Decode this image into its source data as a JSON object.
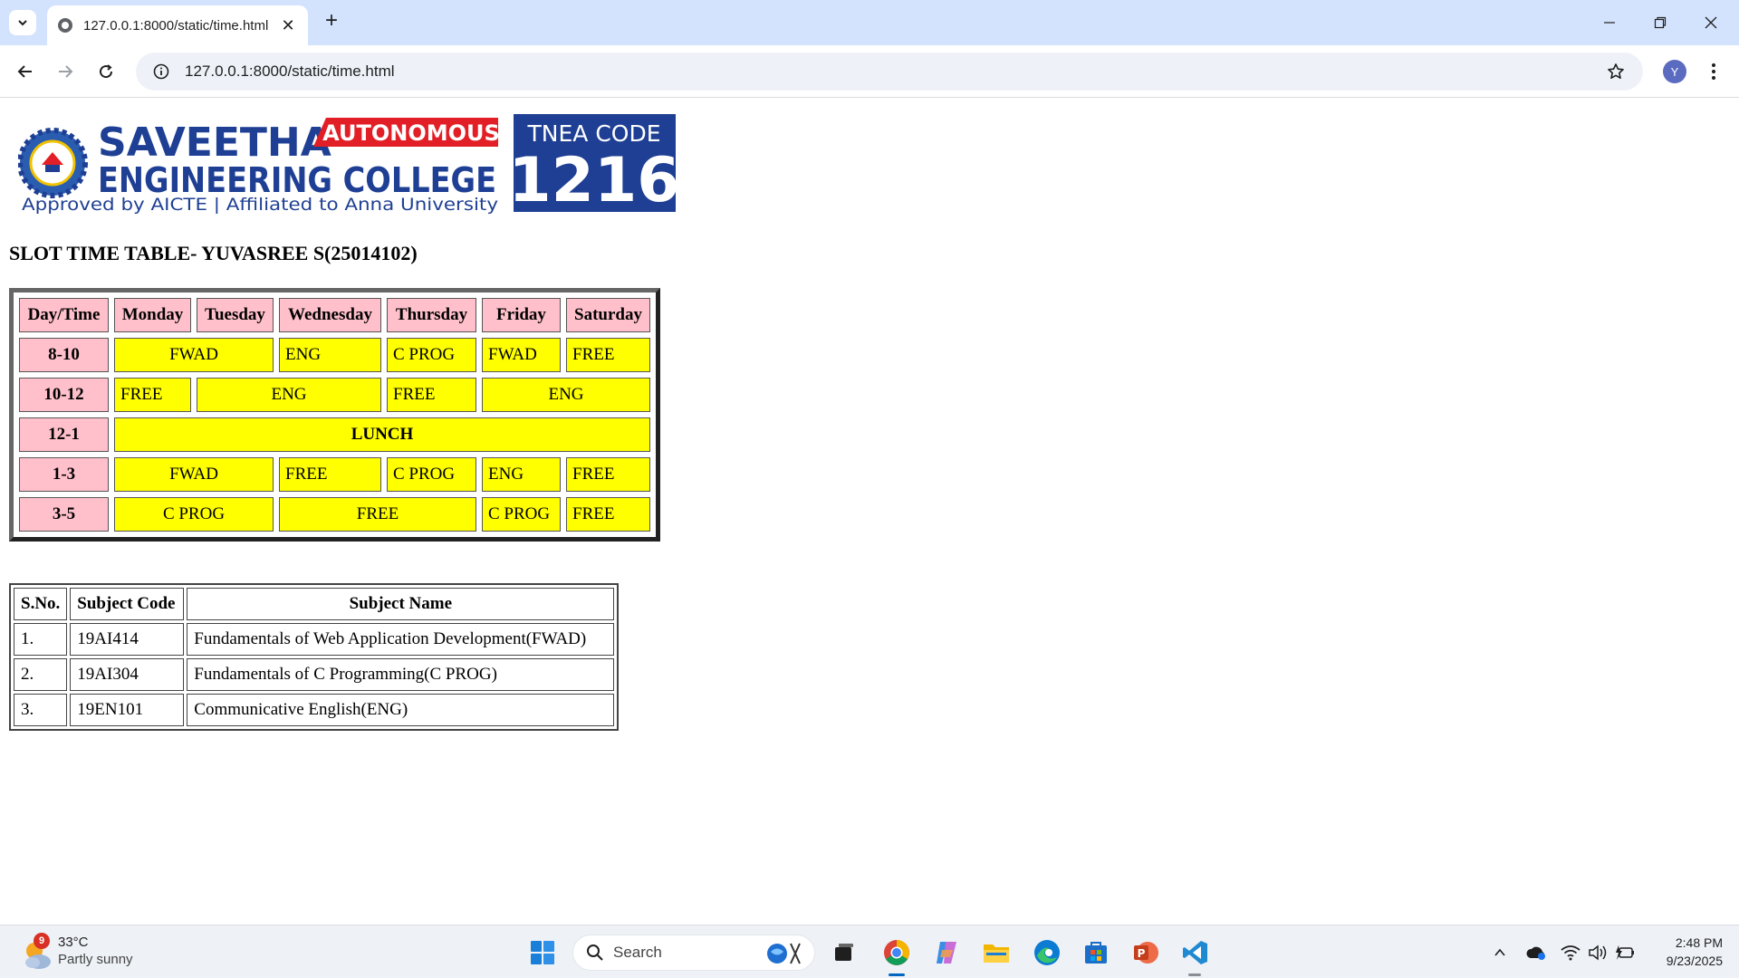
{
  "browser": {
    "tab_title": "127.0.0.1:8000/static/time.html",
    "url": "127.0.0.1:8000/static/time.html",
    "profile_initial": "Y"
  },
  "page": {
    "logo": {
      "name_line1": "SAVEETHA",
      "badge": "AUTONOMOUS",
      "name_line2": "ENGINEERING COLLEGE",
      "tagline": "Approved by AICTE  |  Affiliated to Anna University",
      "code_label": "TNEA CODE",
      "code_number": "1216"
    },
    "heading": "SLOT TIME TABLE- YUVASREE S(25014102)",
    "timetable": {
      "headers": [
        "Day/Time",
        "Monday",
        "Tuesday",
        "Wednesday",
        "Thursday",
        "Friday",
        "Saturday"
      ],
      "rows": [
        {
          "time": "8-10",
          "cells": [
            "FWAD",
            "ENG",
            "C PROG",
            "FWAD",
            "FREE"
          ]
        },
        {
          "time": "10-12",
          "cells": [
            "FREE",
            "ENG",
            "FREE",
            "ENG"
          ]
        },
        {
          "time": "12-1",
          "cells": [
            "LUNCH"
          ]
        },
        {
          "time": "1-3",
          "cells": [
            "FWAD",
            "FREE",
            "C PROG",
            "ENG",
            "FREE"
          ]
        },
        {
          "time": "3-5",
          "cells": [
            "C PROG",
            "FREE",
            "C PROG",
            "FREE"
          ]
        }
      ]
    },
    "subjects": {
      "headers": [
        "S.No.",
        "Subject Code",
        "Subject Name"
      ],
      "rows": [
        {
          "sno": "1.",
          "code": "19AI414",
          "name": "Fundamentals of Web Application Development(FWAD)"
        },
        {
          "sno": "2.",
          "code": "19AI304",
          "name": "Fundamentals of C Programming(C PROG)"
        },
        {
          "sno": "3.",
          "code": "19EN101",
          "name": "Communicative English(ENG)"
        }
      ]
    }
  },
  "taskbar": {
    "weather_badge": "9",
    "weather_temp": "33°C",
    "weather_desc": "Partly sunny",
    "search_placeholder": "Search",
    "time": "2:48 PM",
    "date": "9/23/2025"
  },
  "colors": {
    "header_cell": "#ffc0cb",
    "slot_cell": "#ffff00",
    "tab_strip": "#d3e3fd",
    "logo_blue": "#1e3f94",
    "logo_red": "#e21f26"
  }
}
